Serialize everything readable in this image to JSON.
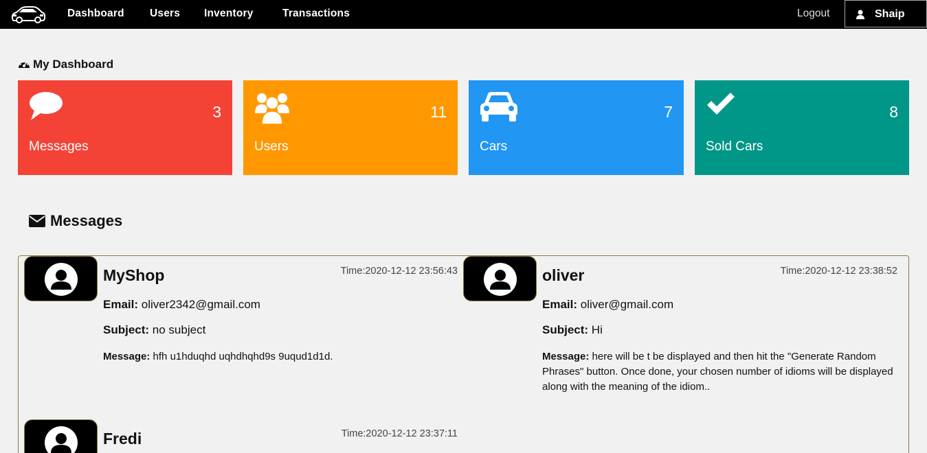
{
  "nav": {
    "logo_icon": "car-logo-icon",
    "items": [
      "Dashboard",
      "Users",
      "Inventory",
      "Transactions"
    ],
    "logout": "Logout",
    "user": "Shaip",
    "user_icon": "user-icon"
  },
  "dashboard": {
    "title": "My Dashboard",
    "title_icon": "dashboard-icon",
    "cards": [
      {
        "label": "Messages",
        "count": "3",
        "icon": "comment-icon",
        "color": "#f44336"
      },
      {
        "label": "Users",
        "count": "11",
        "icon": "users-icon",
        "color": "#ff9800"
      },
      {
        "label": "Cars",
        "count": "7",
        "icon": "car-icon",
        "color": "#2196f3"
      },
      {
        "label": "Sold Cars",
        "count": "8",
        "icon": "check-icon",
        "color": "#009688"
      }
    ]
  },
  "messages": {
    "title": "Messages",
    "title_icon": "envelope-icon",
    "email_label": "Email:",
    "subject_label": "Subject:",
    "message_label": "Message:",
    "items": [
      {
        "name": "MyShop",
        "time": "Time:2020-12-12 23:56:43",
        "email": "oliver2342@gmail.com",
        "subject": "no subject",
        "message": "hfh u1hduqhd uqhdhqhd9s 9uqud1d1d."
      },
      {
        "name": "oliver",
        "time": "Time:2020-12-12 23:38:52",
        "email": "oliver@gmail.com",
        "subject": "Hi",
        "message": "here will be t be displayed and then hit the \"Generate Random Phrases\" button. Once done, your chosen number of idioms will be displayed along with the meaning of the idiom.."
      },
      {
        "name": "Fredi",
        "time": "Time:2020-12-12 23:37:11",
        "email": "",
        "subject": "",
        "message": ""
      }
    ]
  }
}
